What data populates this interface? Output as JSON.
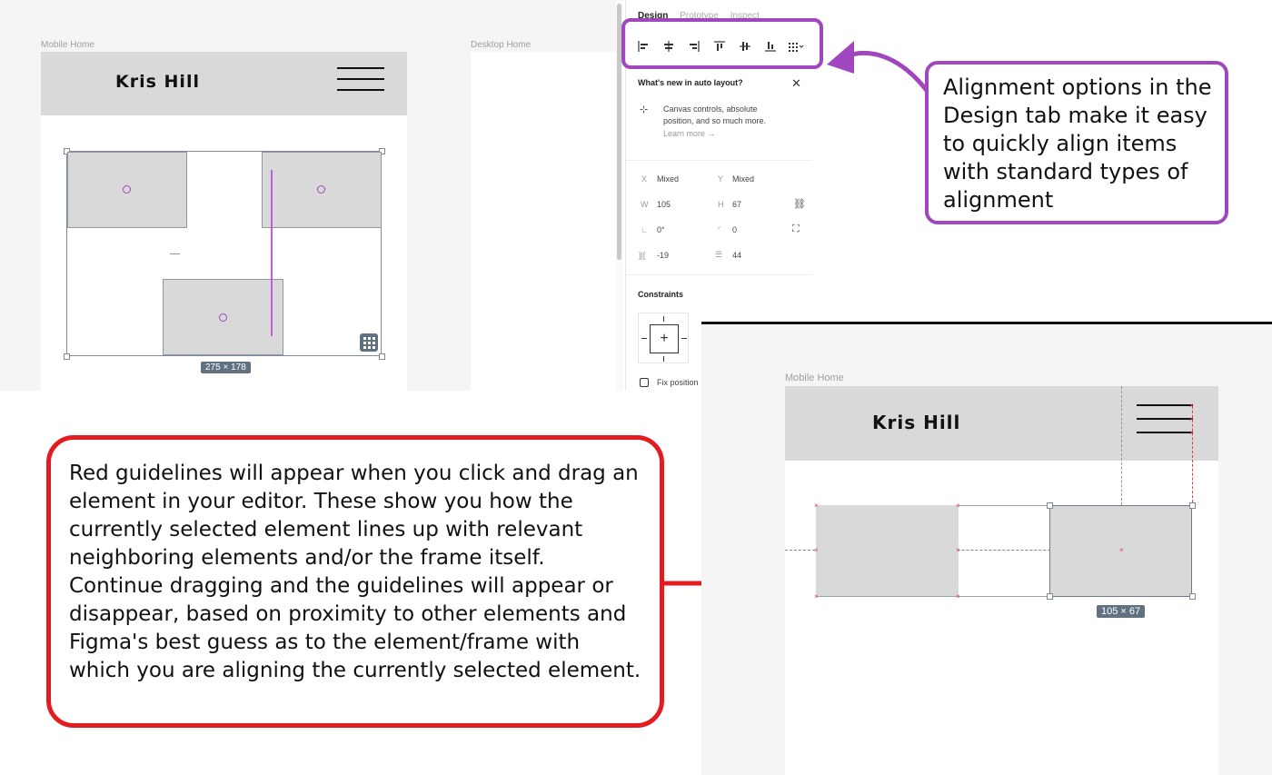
{
  "canvas_top": {
    "mobile_label": "Mobile Home",
    "desktop_label": "Desktop Home",
    "logo": "Kris Hill",
    "selection_size": "275 × 178"
  },
  "panel": {
    "tabs": [
      "Design",
      "Prototype",
      "Inspect"
    ],
    "auto_layout_title": "What's new in auto layout?",
    "auto_layout_desc_1": "Canvas controls, absolute",
    "auto_layout_desc_2": "position, and so much more.",
    "learn_more": "Learn more →",
    "props": {
      "x_label": "X",
      "x_value": "Mixed",
      "y_label": "Y",
      "y_value": "Mixed",
      "w_label": "W",
      "w_value": "105",
      "h_label": "H",
      "h_value": "67",
      "rotation": "0°",
      "radius": "0",
      "spacing_h": "-19",
      "spacing_v": "44"
    },
    "constraints_title": "Constraints",
    "fix_position": "Fix position"
  },
  "callouts": {
    "purple": "Alignment options in the Design tab make it easy to quickly align items with standard types of alignment",
    "red": "Red guidelines will appear when you click and drag an element in your editor. These show you how the currently selected element lines up with relevant neighboring elements and/or the frame itself. Continue dragging and the guidelines will appear or disappear, based on proximity to other elements and Figma's best guess as to the element/frame with which you are aligning the currently selected element."
  },
  "canvas_bottom": {
    "mobile_label": "Mobile Home",
    "logo": "Kris Hill",
    "selection_size": "105 × 67"
  },
  "colors": {
    "purple_callout": "#a047c0",
    "red_callout": "#e21c21",
    "guideline_red": "#e04040",
    "selection_blue": "#627182"
  }
}
